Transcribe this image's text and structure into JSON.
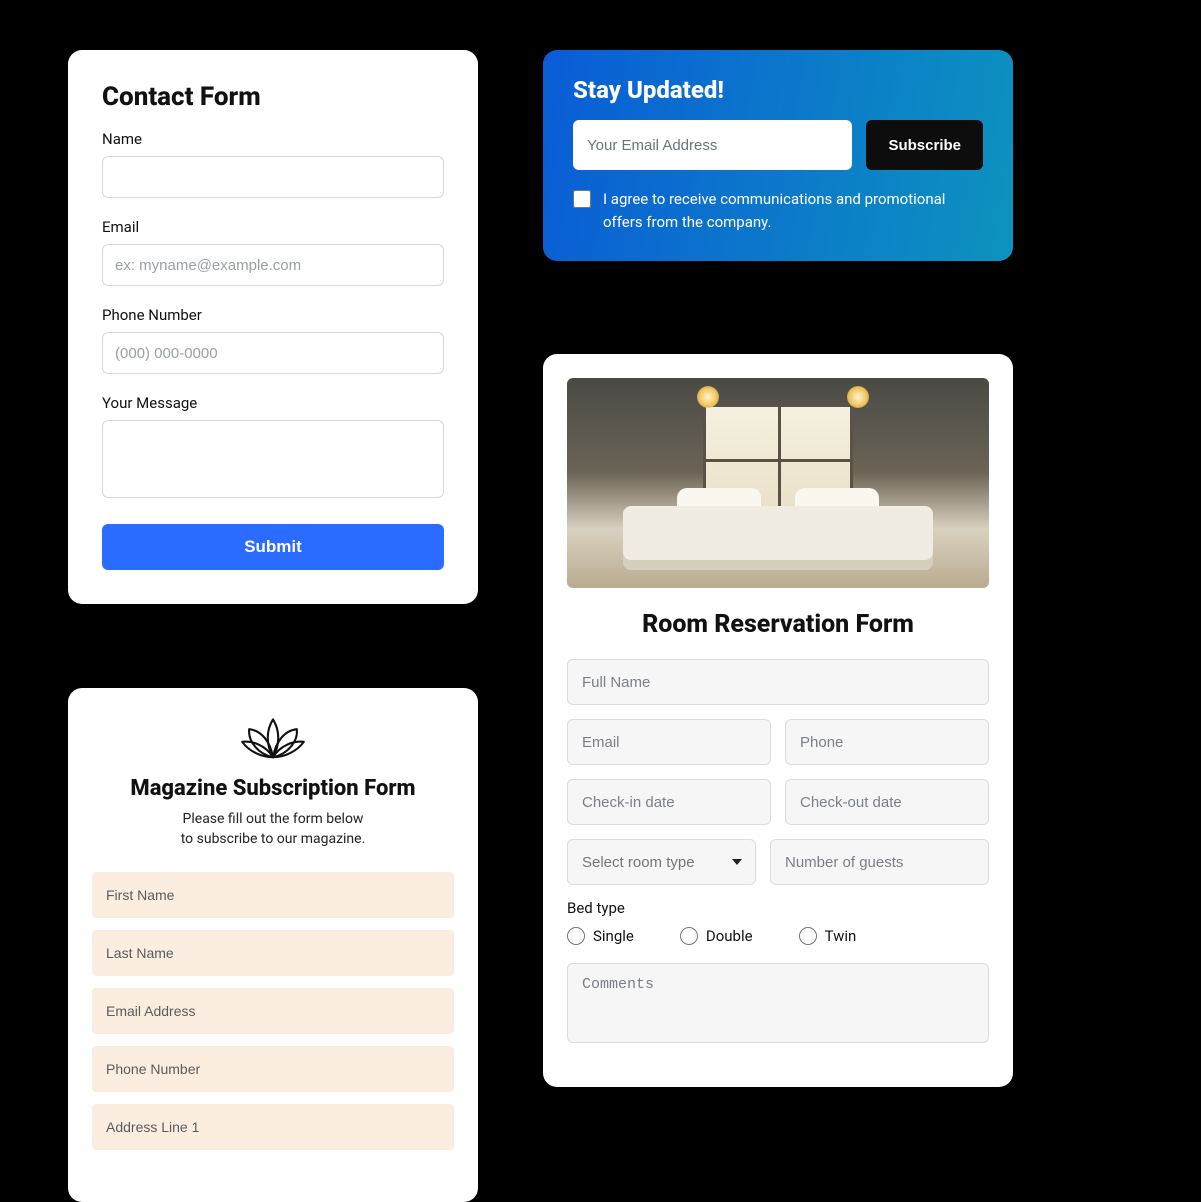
{
  "contact": {
    "title": "Contact Form",
    "name_label": "Name",
    "email_label": "Email",
    "email_placeholder": "ex: myname@example.com",
    "phone_label": "Phone Number",
    "phone_placeholder": "(000) 000-0000",
    "message_label": "Your Message",
    "submit_label": "Submit"
  },
  "stay": {
    "title": "Stay Updated!",
    "email_placeholder": "Your Email Address",
    "subscribe_label": "Subscribe",
    "consent_text": "I agree to receive communications and promotional offers from the company."
  },
  "room": {
    "title": "Room Reservation Form",
    "fullname_placeholder": "Full Name",
    "email_placeholder": "Email",
    "phone_placeholder": "Phone",
    "checkin_placeholder": "Check-in date",
    "checkout_placeholder": "Check-out date",
    "roomtype_placeholder": "Select room type",
    "guests_placeholder": "Number of guests",
    "bedtype_label": "Bed type",
    "bed_options": {
      "single": "Single",
      "double": "Double",
      "twin": "Twin"
    },
    "comments_placeholder": "Comments"
  },
  "magazine": {
    "title": "Magazine Subscription Form",
    "subtitle_line1": "Please fill out the form below",
    "subtitle_line2": "to subscribe to our magazine.",
    "first_name_placeholder": "First Name",
    "last_name_placeholder": "Last Name",
    "email_placeholder": "Email Address",
    "phone_placeholder": "Phone Number",
    "address1_placeholder": "Address Line 1"
  }
}
